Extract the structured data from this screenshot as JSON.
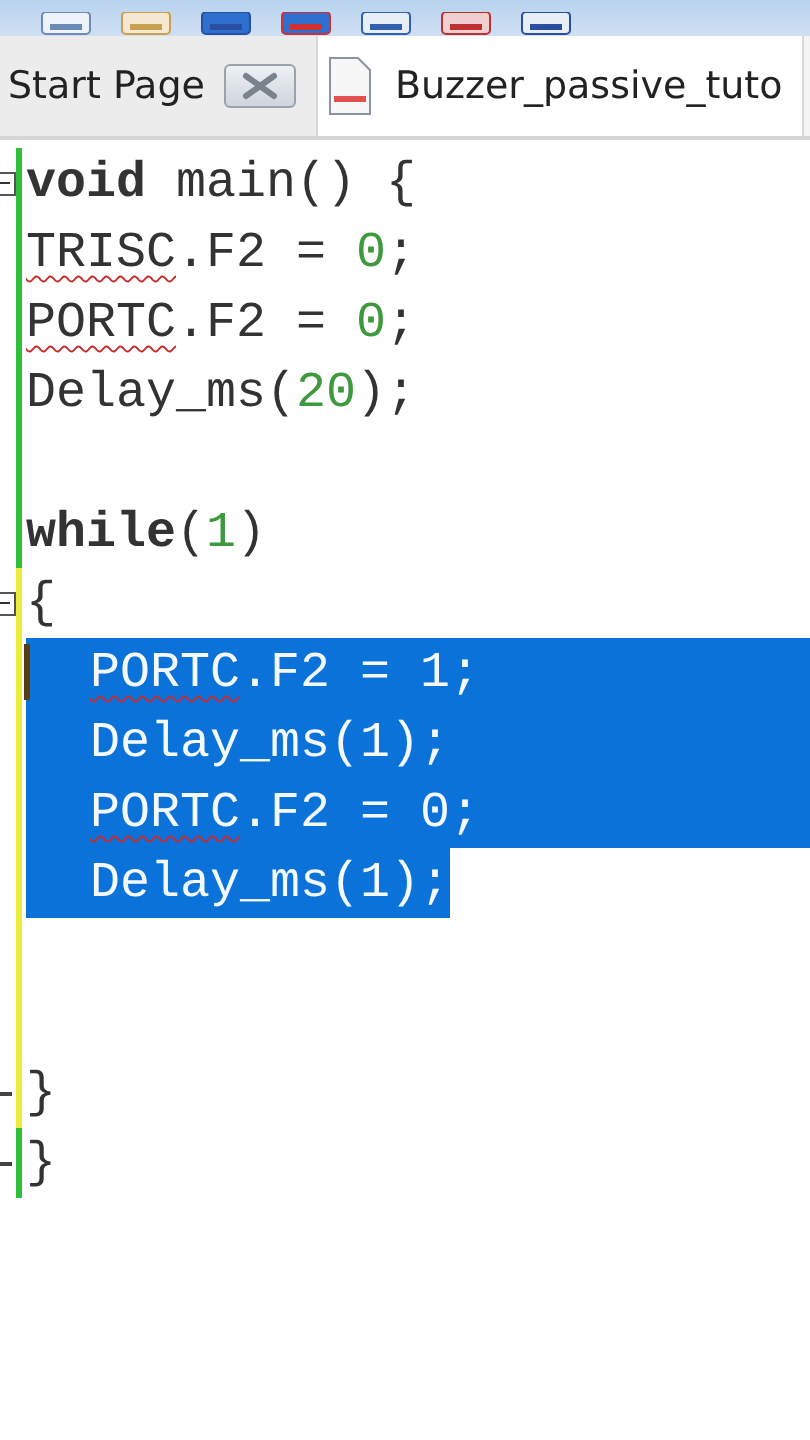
{
  "tabs": [
    {
      "label": "Start Page",
      "selected": false,
      "closable": true,
      "kind": "start"
    },
    {
      "label": "Buzzer_passive_tuto",
      "selected": true,
      "closable": false,
      "kind": "file"
    }
  ],
  "lines": [
    {
      "modified": false,
      "fold_open": true,
      "fold_close": false,
      "selected": false,
      "caret": false,
      "kind": "plain",
      "tokens": [
        {
          "text": "void",
          "kind": "keyword",
          "squiggle": false
        },
        {
          "text": " main() {",
          "kind": "plain",
          "squiggle": false
        }
      ]
    },
    {
      "modified": false,
      "fold_open": false,
      "fold_close": false,
      "selected": false,
      "caret": false,
      "kind": "plain",
      "tokens": [
        {
          "text": "TRISC",
          "kind": "plain",
          "squiggle": true
        },
        {
          "text": ".F2 = ",
          "kind": "plain",
          "squiggle": false
        },
        {
          "text": "0",
          "kind": "number",
          "squiggle": false
        },
        {
          "text": ";",
          "kind": "plain",
          "squiggle": false
        }
      ]
    },
    {
      "modified": false,
      "fold_open": false,
      "fold_close": false,
      "selected": false,
      "caret": false,
      "kind": "plain",
      "tokens": [
        {
          "text": "PORTC",
          "kind": "plain",
          "squiggle": true
        },
        {
          "text": ".F2 = ",
          "kind": "plain",
          "squiggle": false
        },
        {
          "text": "0",
          "kind": "number",
          "squiggle": false
        },
        {
          "text": ";",
          "kind": "plain",
          "squiggle": false
        }
      ]
    },
    {
      "modified": false,
      "fold_open": false,
      "fold_close": false,
      "selected": false,
      "caret": false,
      "kind": "plain",
      "tokens": [
        {
          "text": "Delay_ms(",
          "kind": "plain",
          "squiggle": false
        },
        {
          "text": "20",
          "kind": "number",
          "squiggle": false
        },
        {
          "text": ");",
          "kind": "plain",
          "squiggle": false
        }
      ]
    },
    {
      "modified": false,
      "fold_open": false,
      "fold_close": false,
      "selected": false,
      "caret": false
    },
    {
      "modified": false,
      "fold_open": false,
      "fold_close": false,
      "selected": false,
      "caret": false,
      "kind": "plain",
      "tokens": [
        {
          "text": "while",
          "kind": "keyword",
          "squiggle": false
        },
        {
          "text": "(",
          "kind": "plain",
          "squiggle": false
        },
        {
          "text": "1",
          "kind": "number",
          "squiggle": false
        },
        {
          "text": ")",
          "kind": "plain",
          "squiggle": false
        }
      ]
    },
    {
      "modified": true,
      "fold_open": true,
      "fold_close": false,
      "selected": false,
      "caret": false,
      "kind": "plain",
      "tokens": [
        {
          "text": "{",
          "kind": "plain",
          "squiggle": false
        }
      ]
    },
    {
      "modified": true,
      "fold_open": false,
      "fold_close": false,
      "selected": true,
      "caret": true,
      "kind": "indented",
      "tokens": [
        {
          "text": "PORTC",
          "kind": "plain",
          "squiggle": true
        },
        {
          "text": ".F2 = 1;",
          "kind": "plain",
          "squiggle": false
        }
      ]
    },
    {
      "modified": true,
      "fold_open": false,
      "fold_close": false,
      "selected": true,
      "caret": false,
      "kind": "indented",
      "tokens": [
        {
          "text": "Delay_ms(1);",
          "kind": "plain",
          "squiggle": false
        }
      ]
    },
    {
      "modified": true,
      "fold_open": false,
      "fold_close": false,
      "selected": true,
      "caret": false,
      "kind": "indented",
      "tokens": [
        {
          "text": "PORTC",
          "kind": "plain",
          "squiggle": true
        },
        {
          "text": ".F2 = 0;",
          "kind": "plain",
          "squiggle": false
        }
      ]
    },
    {
      "modified": true,
      "fold_open": false,
      "fold_close": false,
      "selected": true,
      "caret": false,
      "kind": "indented",
      "tokens": [
        {
          "text": "Delay_ms(1);",
          "kind": "plain",
          "squiggle": false
        }
      ]
    },
    {
      "modified": true,
      "fold_open": false,
      "fold_close": false,
      "selected": false,
      "caret": false
    },
    {
      "modified": true,
      "fold_open": false,
      "fold_close": false,
      "selected": false,
      "caret": false
    },
    {
      "modified": true,
      "fold_open": false,
      "fold_close": true,
      "selected": false,
      "caret": false,
      "kind": "plain",
      "tokens": [
        {
          "text": "}",
          "kind": "plain",
          "squiggle": false
        }
      ]
    },
    {
      "modified": false,
      "fold_open": false,
      "fold_close": true,
      "selected": false,
      "caret": false,
      "kind": "plain",
      "tokens": [
        {
          "text": "}",
          "kind": "plain",
          "squiggle": false
        }
      ]
    }
  ]
}
